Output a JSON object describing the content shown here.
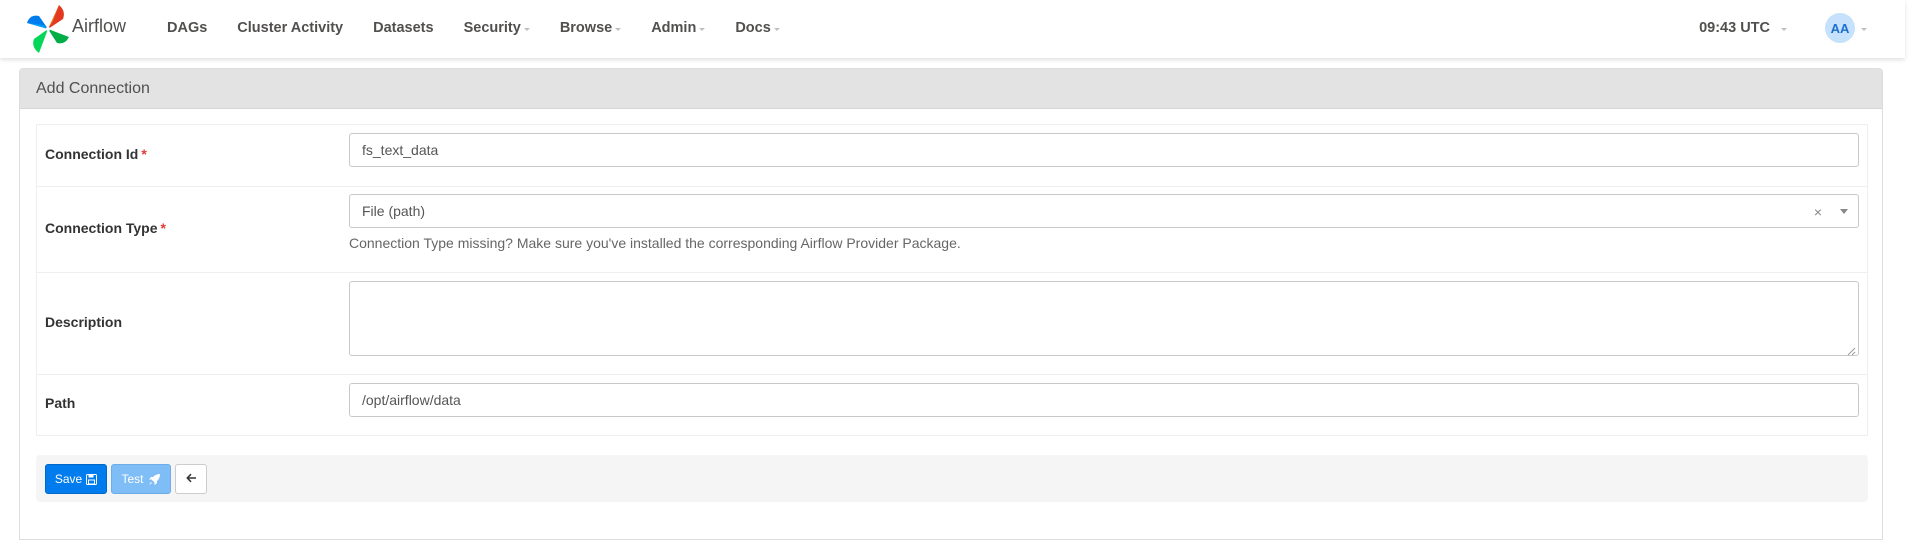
{
  "app": {
    "name": "Airflow"
  },
  "nav": {
    "items": [
      {
        "label": "DAGs",
        "dropdown": false
      },
      {
        "label": "Cluster Activity",
        "dropdown": false
      },
      {
        "label": "Datasets",
        "dropdown": false
      },
      {
        "label": "Security",
        "dropdown": true
      },
      {
        "label": "Browse",
        "dropdown": true
      },
      {
        "label": "Admin",
        "dropdown": true
      },
      {
        "label": "Docs",
        "dropdown": true
      }
    ],
    "clock": "09:43 UTC",
    "user_initials": "AA"
  },
  "panel": {
    "title": "Add Connection"
  },
  "form": {
    "connection_id": {
      "label": "Connection Id",
      "required": "*",
      "value": "fs_text_data"
    },
    "connection_type": {
      "label": "Connection Type",
      "required": "*",
      "value": "File (path)",
      "clear": "×",
      "hint": "Connection Type missing? Make sure you've installed the corresponding Airflow Provider Package."
    },
    "description": {
      "label": "Description",
      "value": ""
    },
    "path": {
      "label": "Path",
      "value": "/opt/airflow/data"
    }
  },
  "actions": {
    "save_label": "Save",
    "test_label": "Test"
  },
  "icons": {
    "logo": "airflow-pinwheel-icon",
    "save": "floppy-disk-icon",
    "test": "rocket-icon",
    "back": "arrow-left-icon"
  },
  "colors": {
    "primary": "#017cee",
    "primary_disabled": "#7fbdf6",
    "required": "#e53935",
    "heading_bg": "#e3e3e3",
    "avatar_bg": "#c5e1fb"
  }
}
